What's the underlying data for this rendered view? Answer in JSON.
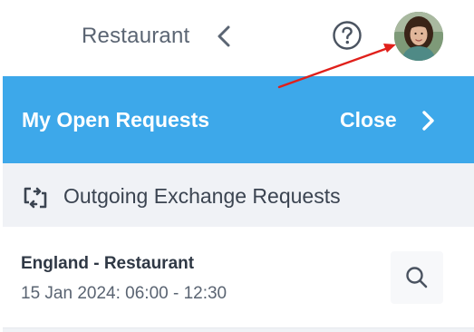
{
  "topbar": {
    "title": "Restaurant",
    "back_icon": "chevron-left-icon",
    "help_icon": "question-circle-icon",
    "avatar_icon": "user-avatar"
  },
  "panel": {
    "heading": "My Open Requests",
    "close_label": "Close",
    "close_icon": "chevron-right-icon",
    "accent_color": "#3da8ea"
  },
  "section": {
    "icon": "exchange-arrows-icon",
    "title": "Outgoing Exchange Requests"
  },
  "requests": [
    {
      "title": "England - Restaurant",
      "datetime": "15 Jan 2024: 06:00 - 12:30",
      "action_icon": "search-icon"
    }
  ],
  "annotation": {
    "type": "red-arrow",
    "points_to": "avatar",
    "color": "#e0201b"
  }
}
